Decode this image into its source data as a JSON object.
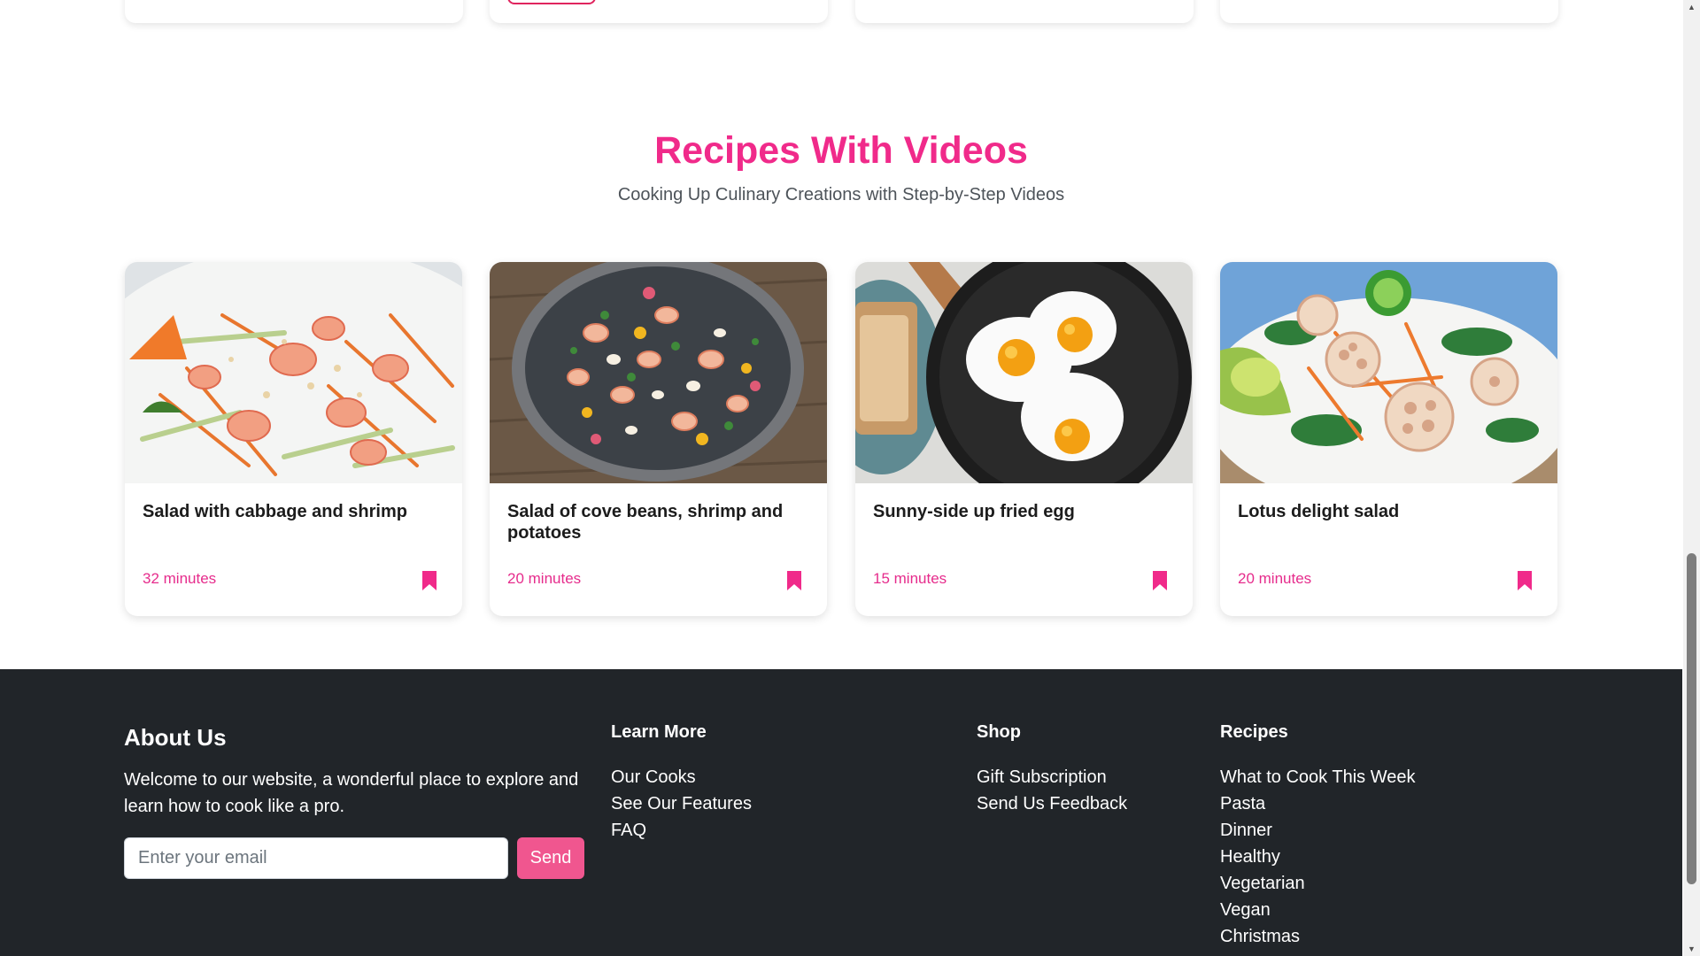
{
  "section": {
    "title": "Recipes With Videos",
    "subtitle": "Cooking Up Culinary Creations with Step-by-Step Videos"
  },
  "recipes": [
    {
      "title": "Salad with cabbage and shrimp",
      "time": "32 minutes",
      "image": "shrimp-cabbage-salad-photo"
    },
    {
      "title": "Salad of cove beans, shrimp and potatoes",
      "time": "20 minutes",
      "image": "bean-shrimp-salad-bowl-photo"
    },
    {
      "title": "Sunny-side up fried egg",
      "time": "15 minutes",
      "image": "fried-eggs-skillet-photo"
    },
    {
      "title": "Lotus delight salad",
      "time": "20 minutes",
      "image": "lotus-root-salad-photo"
    }
  ],
  "footer": {
    "about": {
      "title": "About Us",
      "text": "Welcome to our website, a wonderful place to explore and learn how to cook like a pro.",
      "email_placeholder": "Enter your email",
      "send_label": "Send"
    },
    "learn_more": {
      "title": "Learn More",
      "links": [
        "Our Cooks",
        "See Our Features",
        "FAQ"
      ]
    },
    "shop": {
      "title": "Shop",
      "links": [
        "Gift Subscription",
        "Send Us Feedback"
      ]
    },
    "recipes": {
      "title": "Recipes",
      "links": [
        "What to Cook This Week",
        "Pasta",
        "Dinner",
        "Healthy",
        "Vegetarian",
        "Vegan",
        "Christmas"
      ]
    }
  },
  "colors": {
    "accent": "#f02a8a",
    "footer_bg": "#212529",
    "send_button": "#f0568f"
  },
  "icons": {
    "bookmark": "bookmark-icon"
  }
}
